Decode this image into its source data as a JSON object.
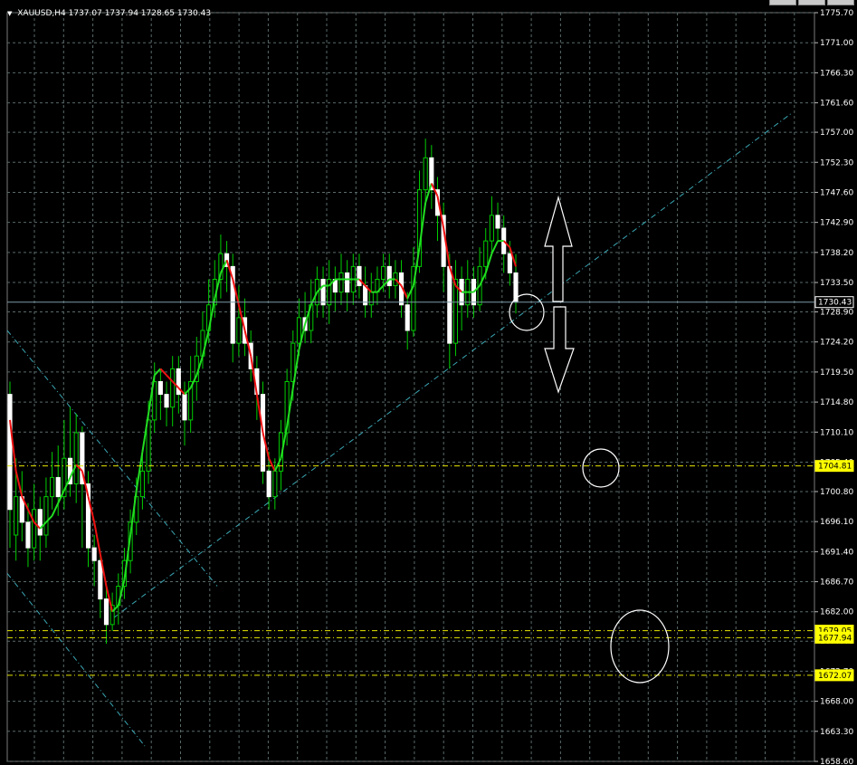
{
  "header": {
    "symbol_line": "XAUUSD,H4  1737.07 1737.94 1728.65 1730.43"
  },
  "colors": {
    "background": "#000000",
    "grid": "#5a6a6a",
    "axis_text": "#ffffff",
    "candle_body": "#ffffff",
    "candle_wick": "#00cc00",
    "ma_up": "#22dd22",
    "ma_down": "#ee1111",
    "trend_line": "#3aa6b3",
    "level_line": "#e6e600",
    "label_bg": "#ffff00",
    "current_price_line": "#7a9aa6"
  },
  "chart_data": {
    "type": "candlestick",
    "symbol": "XAUUSD",
    "timeframe": "H4",
    "ylim": [
      1658.6,
      1775.7
    ],
    "y_ticks": [
      "1775.70",
      "1771.00",
      "1766.30",
      "1761.60",
      "1757.00",
      "1752.30",
      "1747.60",
      "1742.90",
      "1738.20",
      "1733.50",
      "1728.90",
      "1724.20",
      "1719.50",
      "1714.80",
      "1710.10",
      "1705.40",
      "1700.80",
      "1696.10",
      "1691.40",
      "1686.70",
      "1682.00",
      "1677.40",
      "1672.70",
      "1668.00",
      "1663.30",
      "1658.60"
    ],
    "candles": [
      [
        1716,
        1698,
        1718,
        1692
      ],
      [
        1694,
        1700,
        1706,
        1690
      ],
      [
        1700,
        1696,
        1704,
        1693
      ],
      [
        1696,
        1692,
        1699,
        1689
      ],
      [
        1692,
        1698,
        1702,
        1690
      ],
      [
        1698,
        1694,
        1700,
        1690
      ],
      [
        1694,
        1700,
        1703,
        1692
      ],
      [
        1700,
        1703,
        1707,
        1698
      ],
      [
        1703,
        1700,
        1708,
        1697
      ],
      [
        1700,
        1706,
        1712,
        1698
      ],
      [
        1706,
        1702,
        1714,
        1700
      ],
      [
        1702,
        1710,
        1713,
        1699
      ],
      [
        1710,
        1702,
        1711,
        1692
      ],
      [
        1702,
        1692,
        1704,
        1689
      ],
      [
        1692,
        1690,
        1694,
        1686
      ],
      [
        1690,
        1684,
        1691,
        1681
      ],
      [
        1684,
        1680,
        1686,
        1677
      ],
      [
        1680,
        1683,
        1685,
        1679
      ],
      [
        1683,
        1686,
        1688,
        1680
      ],
      [
        1686,
        1690,
        1692,
        1684
      ],
      [
        1690,
        1696,
        1698,
        1688
      ],
      [
        1696,
        1700,
        1703,
        1694
      ],
      [
        1700,
        1704,
        1707,
        1698
      ],
      [
        1704,
        1712,
        1715,
        1702
      ],
      [
        1712,
        1718,
        1721,
        1710
      ],
      [
        1718,
        1716,
        1720,
        1712
      ],
      [
        1716,
        1714,
        1718,
        1711
      ],
      [
        1714,
        1720,
        1722,
        1711
      ],
      [
        1720,
        1716,
        1722,
        1713
      ],
      [
        1716,
        1712,
        1718,
        1708
      ],
      [
        1712,
        1718,
        1722,
        1710
      ],
      [
        1718,
        1722,
        1725,
        1715
      ],
      [
        1722,
        1726,
        1729,
        1720
      ],
      [
        1726,
        1730,
        1734,
        1724
      ],
      [
        1730,
        1734,
        1737,
        1728
      ],
      [
        1734,
        1738,
        1741,
        1731
      ],
      [
        1738,
        1736,
        1740,
        1732
      ],
      [
        1736,
        1724,
        1738,
        1721
      ],
      [
        1724,
        1728,
        1733,
        1722
      ],
      [
        1728,
        1724,
        1731,
        1722
      ],
      [
        1724,
        1720,
        1726,
        1718
      ],
      [
        1720,
        1716,
        1722,
        1712
      ],
      [
        1716,
        1704,
        1718,
        1702
      ],
      [
        1704,
        1700,
        1707,
        1698
      ],
      [
        1700,
        1704,
        1706,
        1698
      ],
      [
        1704,
        1710,
        1712,
        1701
      ],
      [
        1710,
        1718,
        1720,
        1708
      ],
      [
        1718,
        1724,
        1726,
        1715
      ],
      [
        1724,
        1728,
        1731,
        1722
      ],
      [
        1728,
        1726,
        1732,
        1724
      ],
      [
        1726,
        1730,
        1734,
        1724
      ],
      [
        1730,
        1734,
        1736,
        1728
      ],
      [
        1734,
        1730,
        1736,
        1728
      ],
      [
        1730,
        1734,
        1737,
        1727
      ],
      [
        1734,
        1732,
        1736,
        1729
      ],
      [
        1732,
        1735,
        1738,
        1730
      ],
      [
        1735,
        1732,
        1737,
        1729
      ],
      [
        1732,
        1736,
        1738,
        1730
      ],
      [
        1736,
        1733,
        1738,
        1731
      ],
      [
        1733,
        1730,
        1736,
        1728
      ],
      [
        1730,
        1732,
        1735,
        1728
      ],
      [
        1732,
        1734,
        1736,
        1730
      ],
      [
        1734,
        1736,
        1738,
        1732
      ],
      [
        1736,
        1733,
        1738,
        1731
      ],
      [
        1733,
        1735,
        1737,
        1731
      ],
      [
        1735,
        1730,
        1737,
        1728
      ],
      [
        1730,
        1726,
        1732,
        1723
      ],
      [
        1726,
        1736,
        1739,
        1725
      ],
      [
        1736,
        1748,
        1751,
        1735
      ],
      [
        1748,
        1753,
        1756,
        1746
      ],
      [
        1753,
        1748,
        1755,
        1745
      ],
      [
        1748,
        1744,
        1750,
        1740
      ],
      [
        1744,
        1736,
        1746,
        1732
      ],
      [
        1736,
        1724,
        1738,
        1720
      ],
      [
        1724,
        1734,
        1737,
        1722
      ],
      [
        1734,
        1730,
        1736,
        1726
      ],
      [
        1730,
        1734,
        1737,
        1728
      ],
      [
        1734,
        1730,
        1736,
        1728
      ],
      [
        1730,
        1736,
        1739,
        1729
      ],
      [
        1736,
        1740,
        1742,
        1734
      ],
      [
        1740,
        1744,
        1747,
        1738
      ],
      [
        1744,
        1742,
        1746,
        1740
      ],
      [
        1742,
        1738,
        1744,
        1735
      ],
      [
        1738,
        1735,
        1740,
        1733
      ],
      [
        1735,
        1730.43,
        1737.94,
        1728.65
      ]
    ],
    "ma": [
      1712,
      1704,
      1700,
      1698,
      1696,
      1695,
      1696,
      1697,
      1699,
      1701,
      1703,
      1705,
      1704,
      1700,
      1696,
      1691,
      1686,
      1682,
      1683,
      1687,
      1694,
      1701,
      1707,
      1713,
      1719,
      1720,
      1719,
      1718,
      1717,
      1716,
      1717,
      1719,
      1722,
      1726,
      1731,
      1735,
      1737,
      1734,
      1730,
      1726,
      1722,
      1716,
      1710,
      1706,
      1704,
      1706,
      1711,
      1717,
      1723,
      1727,
      1730,
      1732,
      1733,
      1733,
      1734,
      1734,
      1734,
      1734,
      1734,
      1733,
      1732,
      1732,
      1733,
      1734,
      1734,
      1733,
      1731,
      1733,
      1739,
      1746,
      1749,
      1747,
      1742,
      1736,
      1733,
      1732,
      1732,
      1732,
      1733,
      1735,
      1738,
      1740,
      1740,
      1739,
      1736
    ],
    "levels": [
      {
        "label": "1730.43"
      },
      {
        "label": "1704.81"
      },
      {
        "label": "1679.05"
      },
      {
        "label": "1677.94"
      },
      {
        "label": "1672.07"
      }
    ]
  }
}
